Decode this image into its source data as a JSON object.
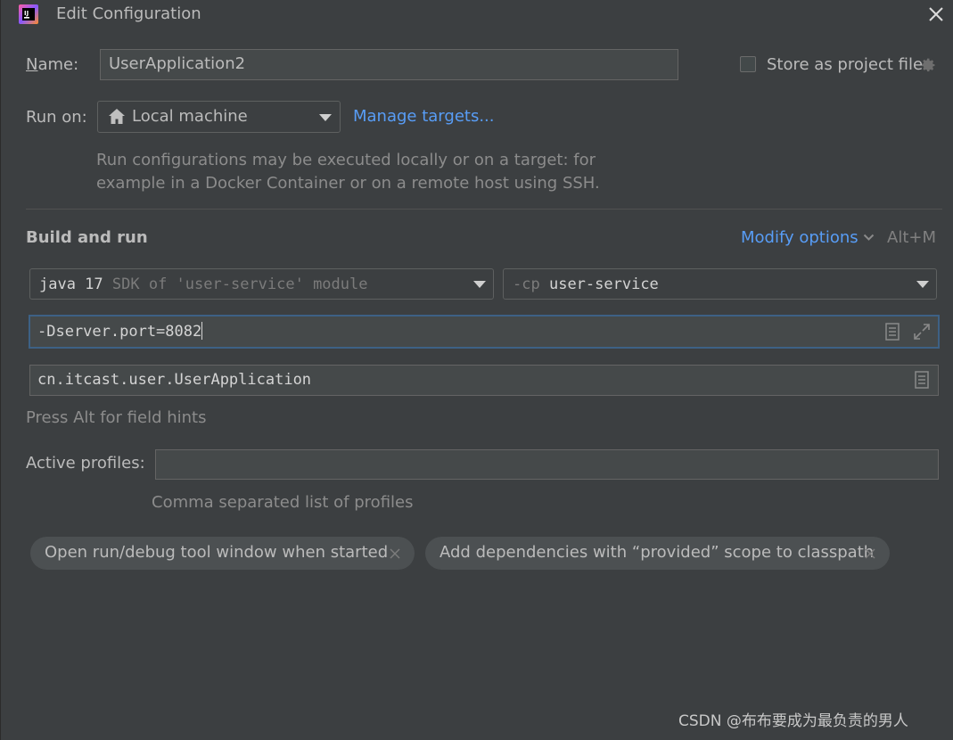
{
  "window": {
    "title": "Edit Configuration",
    "icons": {
      "app": "intellij-logo-icon",
      "close": "close-icon"
    }
  },
  "name": {
    "label_initial": "N",
    "label_rest": "ame:",
    "value": "UserApplication2"
  },
  "store_project_file": {
    "label": "Store as project file",
    "checked": false,
    "icon": "gear-icon"
  },
  "run_on": {
    "label": "Run on:",
    "value": "Local machine",
    "icon": "house-icon",
    "manage_link": "Manage targets...",
    "hint_line1": "Run configurations may be executed locally or on a target: for",
    "hint_line2": "example in a Docker Container or on a remote host using SSH."
  },
  "build_and_run": {
    "title": "Build and run",
    "modify_options": "Modify options",
    "shortcut": "Alt+M",
    "jdk": {
      "primary": "java 17",
      "secondary": "SDK of 'user-service' module"
    },
    "classpath": {
      "prefix": "-cp",
      "value": "user-service"
    },
    "vm_options": "-Dserver.port=8082",
    "main_class": "cn.itcast.user.UserApplication",
    "field_hint": "Press Alt for field hints"
  },
  "active_profiles": {
    "label": "Active profiles:",
    "value": "",
    "hint": "Comma separated list of profiles"
  },
  "chips": [
    {
      "label": "Open run/debug tool window when started"
    },
    {
      "label": "Add dependencies with “provided” scope to classpath"
    }
  ],
  "watermark": "CSDN @布布要成为最负责的男人",
  "colors": {
    "background": "#3c3f41",
    "field": "#45494a",
    "link": "#589df6",
    "focus_border": "#3d6185",
    "chip": "#4c5052"
  }
}
